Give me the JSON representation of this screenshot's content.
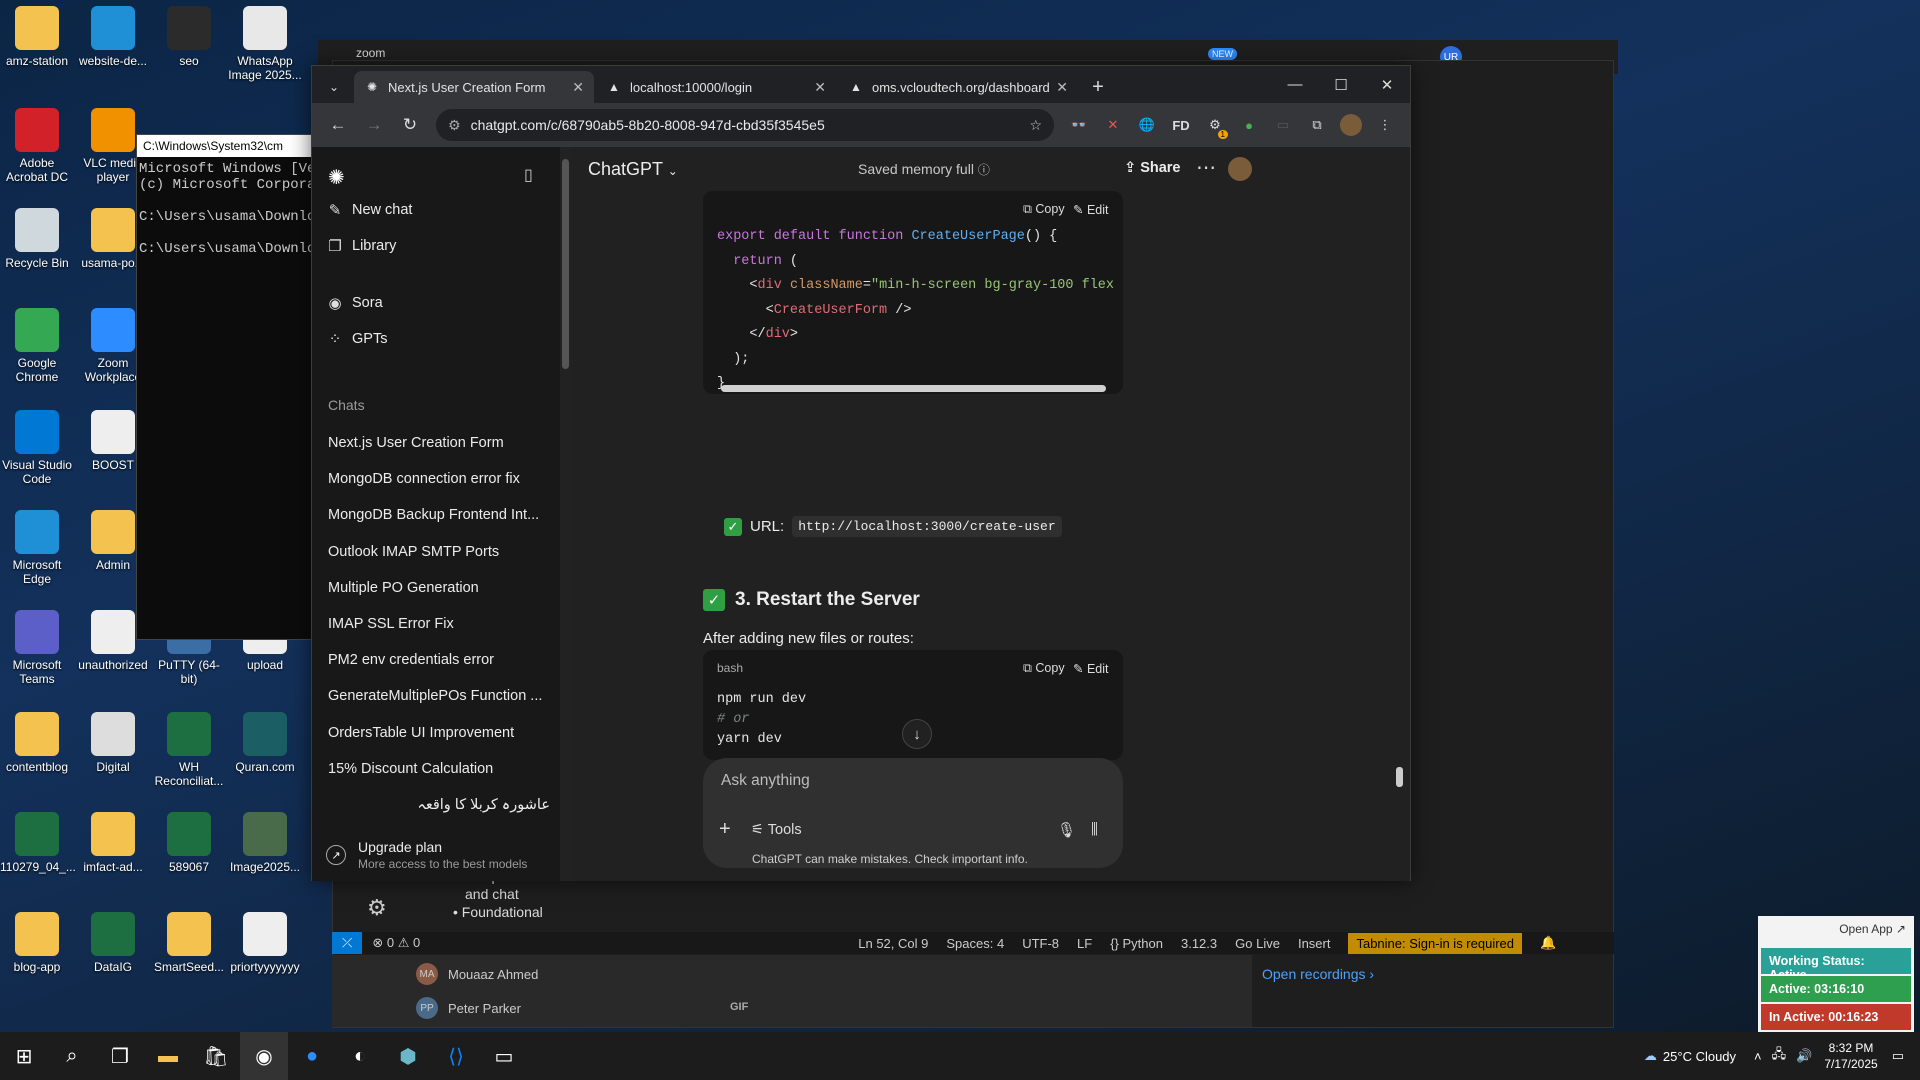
{
  "desktop_icons": [
    {
      "label": "amz-station",
      "icon": "folder-icon",
      "color": "#f3c24f"
    },
    {
      "label": "website-de...",
      "icon": "edge-icon",
      "color": "#1f8fd6"
    },
    {
      "label": "seo",
      "icon": "app-icon",
      "color": "#2b2b2b"
    },
    {
      "label": "WhatsApp Image 2025...",
      "icon": "image-file-icon",
      "color": "#e8e8e8"
    },
    {
      "label": "Adobe Acrobat DC",
      "icon": "acrobat-icon",
      "color": "#d3212a"
    },
    {
      "label": "VLC media player",
      "icon": "vlc-icon",
      "color": "#f29100"
    },
    {
      "label": "Recycle Bin",
      "icon": "recycle-bin-icon",
      "color": "#cfd8dc"
    },
    {
      "label": "usama-po...",
      "icon": "folder-icon",
      "color": "#f3c24f"
    },
    {
      "label": "Google Chrome",
      "icon": "chrome-icon",
      "color": "#34a853"
    },
    {
      "label": "Zoom Workplace",
      "icon": "zoom-icon",
      "color": "#2d8cff"
    },
    {
      "label": "Visual Studio Code",
      "icon": "vscode-icon",
      "color": "#0078d4"
    },
    {
      "label": "BOOST",
      "icon": "document-icon",
      "color": "#eeeeee"
    },
    {
      "label": "Microsoft Edge",
      "icon": "edge-icon",
      "color": "#1f8fd6"
    },
    {
      "label": "Admin",
      "icon": "folder-icon",
      "color": "#f3c24f"
    },
    {
      "label": "Microsoft Teams",
      "icon": "teams-icon",
      "color": "#5b5fc7"
    },
    {
      "label": "unauthorized",
      "icon": "image-file-icon",
      "color": "#eeeeee"
    },
    {
      "label": "PuTTY (64-bit)",
      "icon": "putty-icon",
      "color": "#3b6ea5"
    },
    {
      "label": "upload",
      "icon": "document-icon",
      "color": "#eeeeee"
    },
    {
      "label": "contentblog",
      "icon": "folder-icon",
      "color": "#f3c24f"
    },
    {
      "label": "Digital",
      "icon": "image-file-icon",
      "color": "#dddddd"
    },
    {
      "label": "WH Reconciliat...",
      "icon": "excel-icon",
      "color": "#1d6f42"
    },
    {
      "label": "Quran.com",
      "icon": "quran-icon",
      "color": "#1b5e63"
    },
    {
      "label": "110279_04_...",
      "icon": "excel-icon",
      "color": "#1d6f42"
    },
    {
      "label": "imfact-ad...",
      "icon": "folder-icon",
      "color": "#f3c24f"
    },
    {
      "label": "589067",
      "icon": "excel-icon",
      "color": "#1d6f42"
    },
    {
      "label": "Image2025...",
      "icon": "image-file-icon",
      "color": "#4a6b4a"
    },
    {
      "label": "blog-app",
      "icon": "folder-icon",
      "color": "#f3c24f"
    },
    {
      "label": "DataIG",
      "icon": "excel-icon",
      "color": "#1d6f42"
    },
    {
      "label": "SmartSeed...",
      "icon": "folder-icon",
      "color": "#f3c24f"
    },
    {
      "label": "priortyyyyyyy",
      "icon": "image-file-icon",
      "color": "#eeeeee"
    }
  ],
  "cmd": {
    "title": "C:\\Windows\\System32\\cm",
    "lines": [
      "Microsoft Windows [Ver",
      "(c) Microsoft Corporat",
      "",
      "C:\\Users\\usama\\Downlo",
      "",
      "C:\\Users\\usama\\Downlo"
    ]
  },
  "zoom_label": "zoom",
  "zoom_new_badge": "NEW",
  "zoom_avatar": "UR",
  "browser": {
    "tabs": [
      {
        "label": "Next.js User Creation Form",
        "icon": "chatgpt-icon",
        "active": true
      },
      {
        "label": "localhost:10000/login",
        "icon": "triangle-icon",
        "active": false
      },
      {
        "label": "oms.vcloudtech.org/dashboard",
        "icon": "triangle-icon",
        "active": false
      }
    ],
    "url": "chatgpt.com/c/68790ab5-8b20-8008-947d-cbd35f3545e5",
    "ext_badge": "1",
    "ext_fd": "FD"
  },
  "chatgpt": {
    "sidebar": {
      "new_chat": "New chat",
      "library": "Library",
      "sora": "Sora",
      "gpts": "GPTs",
      "chats_heading": "Chats",
      "chats": [
        "Next.js User Creation Form",
        "MongoDB connection error fix",
        "MongoDB Backup Frontend Int...",
        "Outlook IMAP SMTP Ports",
        "Multiple PO Generation",
        "IMAP SSL Error Fix",
        "PM2 env credentials error",
        "GenerateMultiplePOs Function ...",
        "OrdersTable UI Improvement",
        "15% Discount Calculation",
        "عاشورہ کربلا کا واقعہ"
      ],
      "upgrade_title": "Upgrade plan",
      "upgrade_sub": "More access to the best models"
    },
    "topbar": {
      "model": "ChatGPT",
      "memory": "Saved memory full",
      "share": "Share"
    },
    "code1": {
      "copy": "Copy",
      "edit": "Edit"
    },
    "url_label": "URL:",
    "url_value": "http://localhost:3000/create-user",
    "heading": "3. Restart the Server",
    "paragraph": "After adding new files or routes:",
    "code2": {
      "lang": "bash",
      "copy": "Copy",
      "edit": "Edit",
      "lines": [
        "npm run dev",
        "# or",
        "yarn dev"
      ]
    },
    "composer": {
      "placeholder": "Ask anything",
      "tools": "Tools"
    },
    "disclaimer": "ChatGPT can make mistakes. Check important info."
  },
  "vscode_status": {
    "errors": "⊗ 0 ⚠ 0",
    "position": "Ln 52, Col 9",
    "spaces": "Spaces: 4",
    "encoding": "UTF-8",
    "eol": "LF",
    "language": "{} Python",
    "version": "3.12.3",
    "golive": "Go Live",
    "mode": "Insert",
    "tabnine": "Tabnine: Sign-in is required",
    "badge": "1"
  },
  "vscode_snippets": {
    "list_items": [
      "completions",
      "and chat",
      "Foundational"
    ]
  },
  "teams": {
    "users": [
      {
        "initials": "MA",
        "name": "Mouaaz Ahmed"
      },
      {
        "initials": "PP",
        "name": "Peter Parker"
      }
    ],
    "open_recordings": "Open recordings",
    "gif": "GIF"
  },
  "status_panel": {
    "open_app": "Open App ↗",
    "working": "Working Status: Active",
    "active": "Active: 03:16:10",
    "inactive": "In Active: 00:16:23",
    "colors": {
      "working": "#2aa198",
      "active": "#2e9e4f",
      "inactive": "#c0392b"
    }
  },
  "taskbar": {
    "weather": "25°C  Cloudy",
    "time": "8:32 PM",
    "date": "7/17/2025"
  }
}
